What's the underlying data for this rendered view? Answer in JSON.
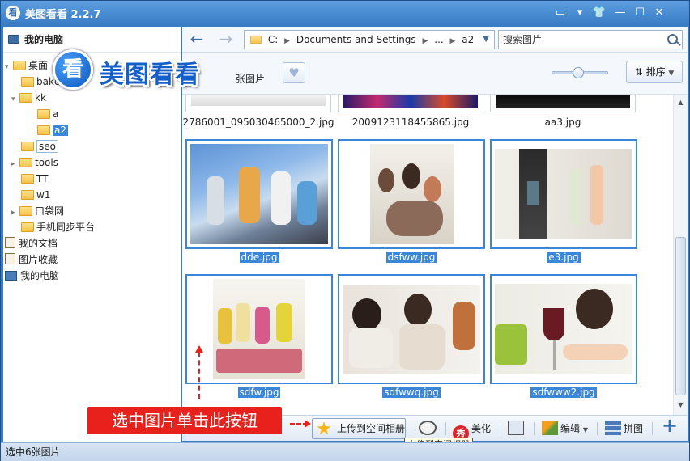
{
  "window": {
    "logo_char": "看",
    "title": "美图看看 2.2.7",
    "title_buttons": [
      "chat-icon",
      "menu-icon",
      "skin-icon",
      "minimize-icon",
      "maximize-icon",
      "close-icon"
    ]
  },
  "sidebar": {
    "header": "我的电脑",
    "items": [
      {
        "label": "桌面",
        "icon": "folder-icon",
        "expanded": true
      },
      {
        "label": "bakc",
        "icon": "folder-icon"
      },
      {
        "label": "kk",
        "icon": "folder-icon",
        "expanded": true
      },
      {
        "label": "a",
        "icon": "folder-icon"
      },
      {
        "label": "a2",
        "icon": "folder-icon",
        "selected": true
      },
      {
        "label": "seo",
        "icon": "folder-icon"
      },
      {
        "label": "tools",
        "icon": "folder-icon"
      },
      {
        "label": "TT",
        "icon": "folder-icon"
      },
      {
        "label": "w1",
        "icon": "folder-icon"
      },
      {
        "label": "口袋网",
        "icon": "folder-icon"
      },
      {
        "label": "手机同步平台",
        "icon": "folder-icon"
      },
      {
        "label": "我的文档",
        "icon": "document-icon"
      },
      {
        "label": "图片收藏",
        "icon": "pictures-icon"
      },
      {
        "label": "我的电脑",
        "icon": "computer-icon"
      }
    ]
  },
  "brand": {
    "circle_char": "看",
    "text": "美图看看"
  },
  "toolbar": {
    "back": "←",
    "forward": "→",
    "path": [
      "C:",
      "Documents and Settings",
      "...",
      "a2"
    ],
    "search_placeholder": "搜索图片"
  },
  "toolbar2": {
    "count_label": "张图片",
    "favorite_glyph": "♥",
    "sort_label": "排序",
    "zoom_level": 0.45
  },
  "images": [
    {
      "name": "2786001_095030465000_2.jpg",
      "selected": false,
      "partial": true
    },
    {
      "name": "2009123118455865.jpg",
      "selected": false,
      "partial": true
    },
    {
      "name": "aa3.jpg",
      "selected": false,
      "partial": true
    },
    {
      "name": "dde.jpg",
      "selected": true
    },
    {
      "name": "dsfww.jpg",
      "selected": true
    },
    {
      "name": "e3.jpg",
      "selected": true
    },
    {
      "name": "sdfw.jpg",
      "selected": true
    },
    {
      "name": "sdfwwq.jpg",
      "selected": true
    },
    {
      "name": "sdfwww2.jpg",
      "selected": true
    }
  ],
  "bottombar": {
    "upload_label": "上传到空间相册",
    "beautify_glyph": "秀",
    "beautify_label": "美化",
    "edit_label": "编辑",
    "puzzle_label": "拼图",
    "add_glyph": "+",
    "tooltip": "上传到空间相册"
  },
  "annotation": {
    "text": "选中图片单击此按钮"
  },
  "status": {
    "text": "选中6张图片"
  }
}
